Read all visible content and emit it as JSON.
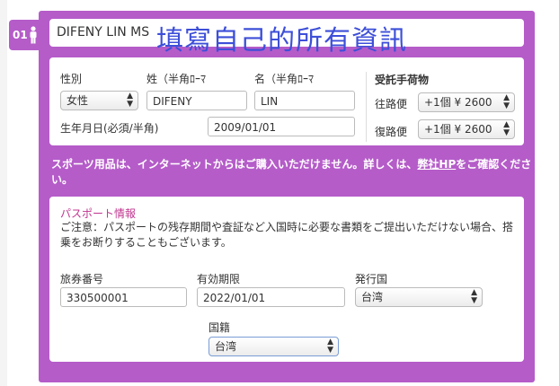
{
  "section_number": "01",
  "icon": "person-icon",
  "accent_color": "#b55cc9",
  "passenger_name": "DIFENY LIN MS",
  "overlay_text": "填寫自己的所有資訊",
  "personal": {
    "gender_label": "性別",
    "gender_value": "女性",
    "surname_label": "姓（半角ﾛｰﾏ",
    "surname_value": "DIFENY",
    "given_label": "名（半角ﾛｰﾏ",
    "given_value": "LIN",
    "dob_label": "生年月日(必須/半角)",
    "dob_value": "2009/01/01"
  },
  "baggage": {
    "title": "受託手荷物",
    "outbound_label": "往路便",
    "outbound_value": "+1個 ¥ 2600",
    "return_label": "復路便",
    "return_value": "+1個 ¥ 2600"
  },
  "notice": {
    "before": "スポーツ用品は、インターネットからはご購入いただけません。詳しくは、",
    "link": "弊社HP",
    "after": "をご確認ください。"
  },
  "passport": {
    "title": "パスポート情報",
    "description": "ご注意：パスポートの残存期間や査証など入国時に必要な書類をご提出いただけない場合、搭乗をお断りすることもございます。",
    "number_label": "旅券番号",
    "number_value": "330500001",
    "expiry_label": "有効期限",
    "expiry_value": "2022/01/01",
    "country_label": "発行国",
    "country_value": "台湾",
    "nationality_label": "国籍",
    "nationality_value": "台湾"
  }
}
